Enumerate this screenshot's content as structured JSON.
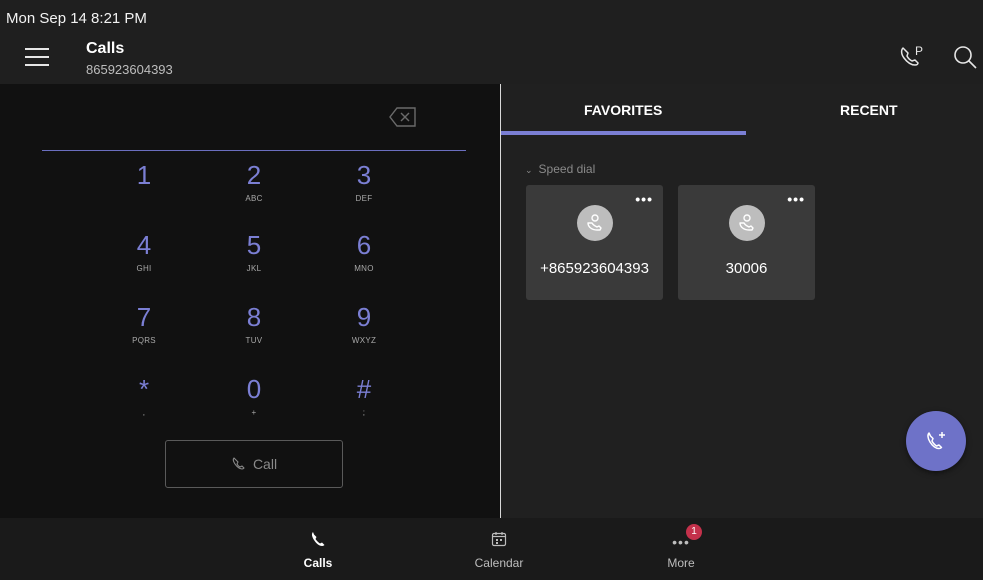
{
  "status_bar": {
    "datetime": "Mon Sep 14  8:21 PM"
  },
  "header": {
    "title": "Calls",
    "subtitle": "865923604393",
    "icons": [
      "menu-icon",
      "park-call-icon",
      "search-icon"
    ]
  },
  "dialpad": {
    "backspace_icon": "backspace-icon",
    "keys": [
      {
        "digit": "1",
        "letters": ""
      },
      {
        "digit": "2",
        "letters": "ABC"
      },
      {
        "digit": "3",
        "letters": "DEF"
      },
      {
        "digit": "4",
        "letters": "GHI"
      },
      {
        "digit": "5",
        "letters": "JKL"
      },
      {
        "digit": "6",
        "letters": "MNO"
      },
      {
        "digit": "7",
        "letters": "PQRS"
      },
      {
        "digit": "8",
        "letters": "TUV"
      },
      {
        "digit": "9",
        "letters": "WXYZ"
      },
      {
        "digit": "*",
        "letters": ","
      },
      {
        "digit": "0",
        "letters": "+"
      },
      {
        "digit": "#",
        "letters": ";"
      }
    ],
    "call_label": "Call"
  },
  "tabs": [
    {
      "label": "FAVORITES",
      "active": true
    },
    {
      "label": "RECENT",
      "active": false
    }
  ],
  "speed_dial": {
    "header": "Speed dial",
    "cards": [
      {
        "number": "+865923604393",
        "more": "•••"
      },
      {
        "number": "30006",
        "more": "•••"
      }
    ]
  },
  "bottom_nav": [
    {
      "label": "Calls",
      "icon": "phone-icon",
      "active": true
    },
    {
      "label": "Calendar",
      "icon": "calendar-icon",
      "active": false
    },
    {
      "label": "More",
      "icon": "more-icon",
      "active": false,
      "badge": "1"
    }
  ],
  "colors": {
    "accent": "#7b7fd4",
    "fab": "#6e72c8",
    "badge": "#c4314b"
  }
}
